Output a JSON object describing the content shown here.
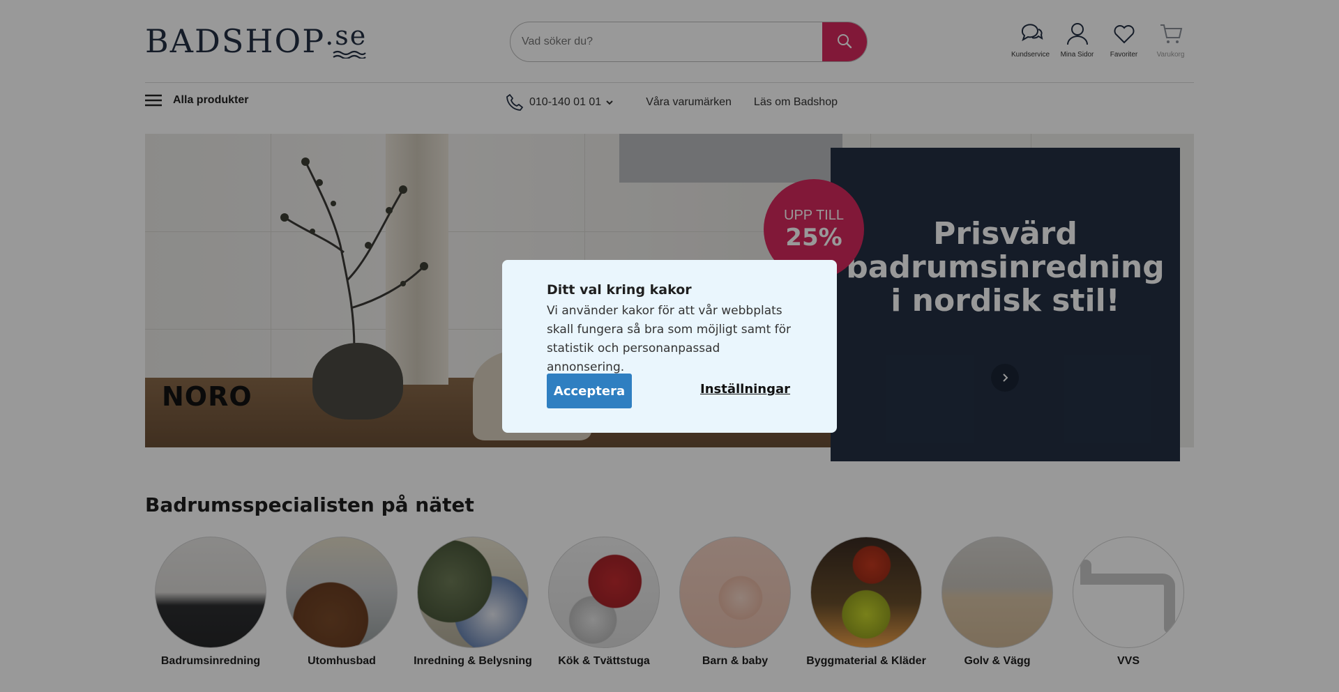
{
  "brand": {
    "logo_text": "BADSHOP",
    "logo_suffix": ".se",
    "accent": "#d8295e",
    "navy": "#233044"
  },
  "header": {
    "search_placeholder": "Vad söker du?",
    "icons": [
      {
        "label": "Kundservice",
        "icon": "chat-icon"
      },
      {
        "label": "Mina Sidor",
        "icon": "user-icon"
      },
      {
        "label": "Favoriter",
        "icon": "heart-icon"
      },
      {
        "label": "Varukorg",
        "icon": "cart-icon"
      }
    ]
  },
  "nav": {
    "all_products": "Alla produkter",
    "phone": "010-140 01 01",
    "links": [
      "Våra varumärken",
      "Läs om Badshop"
    ]
  },
  "hero": {
    "brand_logo": "NORO",
    "badge_line1": "UPP TILL",
    "badge_line2": "25%",
    "promo_title": "Prisvärd badrumsinredning i nordisk stil!"
  },
  "section": {
    "title": "Badrumsspecialisten på nätet",
    "categories": [
      "Badrumsinredning",
      "Utomhusbad",
      "Inredning & Belysning",
      "Kök & Tvättstuga",
      "Barn & baby",
      "Byggmaterial & Kläder",
      "Golv & Vägg",
      "VVS"
    ]
  },
  "cookie": {
    "title": "Ditt val kring kakor",
    "text": "Vi använder kakor för att vår webbplats skall fungera så bra som möjligt samt för statistik och personanpassad annonsering.",
    "accept": "Acceptera",
    "settings": "Inställningar"
  }
}
